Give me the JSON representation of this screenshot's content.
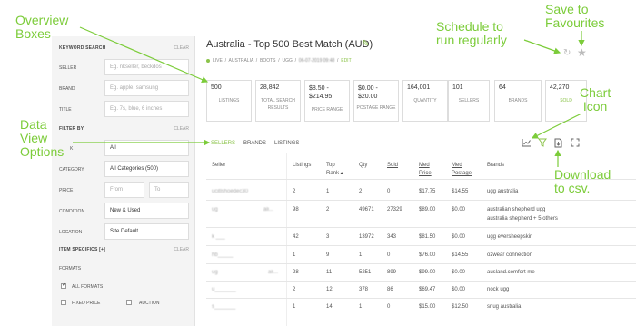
{
  "annotations": {
    "overview_boxes": [
      "Overview",
      "Boxes"
    ],
    "schedule": [
      "Schedule to",
      "run regularly"
    ],
    "favourites": [
      "Save to",
      "Favourites"
    ],
    "data_view": [
      "Data",
      "View",
      "Options"
    ],
    "chart_icon": [
      "Chart",
      "Icon"
    ],
    "download": [
      "Download",
      "to csv."
    ]
  },
  "colors": {
    "accent": "#8bc34a",
    "annotation": "#7ccc3a"
  },
  "sidebar": {
    "keyword_search": {
      "heading": "KEYWORD SEARCH",
      "clear": "CLEAR"
    },
    "seller": {
      "label": "SELLER",
      "placeholder": "Eg. nkseller, beckdos"
    },
    "brand": {
      "label": "BRAND",
      "placeholder": "Eg. apple, samsung"
    },
    "title": {
      "label": "TITLE",
      "placeholder": "Eg. 7s, blue, 6 inches"
    },
    "filter_by": {
      "heading": "FILTER BY",
      "clear": "CLEAR"
    },
    "kind": {
      "label": "K",
      "value": "All"
    },
    "category": {
      "label": "CATEGORY",
      "value": "All Categories (500)"
    },
    "price": {
      "label": "PRICE",
      "from": "From",
      "to": "To"
    },
    "condition": {
      "label": "CONDITION",
      "value": "New & Used"
    },
    "location": {
      "label": "LOCATION",
      "value": "Site Default"
    },
    "item_specifics": {
      "heading": "ITEM SPECIFICS [+]",
      "clear": "CLEAR"
    },
    "formats": {
      "label": "FORMATS",
      "all": "ALL FORMATS",
      "fixed": "FIXED PRICE",
      "auction": "AUCTION"
    }
  },
  "header": {
    "title": "Australia - Top 500 Best Match (AUD)",
    "status": "LIVE",
    "crumbs": [
      "AUSTRALIA",
      "BOOTS",
      "UGG",
      "06-07-2019 09:48"
    ],
    "edit": "EDIT",
    "schedule_icon": "clock-icon",
    "favourite_icon": "star-icon"
  },
  "overview": [
    {
      "value": "500",
      "label": "LISTINGS"
    },
    {
      "value": "28,842",
      "label": "TOTAL SEARCH RESULTS"
    },
    {
      "value": "$8.50 - $214.95",
      "label": "PRICE RANGE"
    },
    {
      "value": "$0.00 - $20.00",
      "label": "POSTAGE RANGE"
    },
    {
      "value": "164,001",
      "label": "QUANTITY"
    },
    {
      "value": "101",
      "label": "SELLERS"
    },
    {
      "value": "64",
      "label": "BRANDS"
    },
    {
      "value": "42,270",
      "label": "SOLD"
    }
  ],
  "tabs": [
    "SELLERS",
    "BRANDS",
    "LISTINGS"
  ],
  "toolbar": {
    "chart": "chart-icon",
    "filter": "filter-icon",
    "download": "download-csv-icon",
    "expand": "expand-icon"
  },
  "table": {
    "headers": [
      "Seller",
      "Listings",
      "Top Rank",
      "Qty",
      "Sold",
      "Med Price",
      "Med Postage",
      "Brands"
    ],
    "rows": [
      {
        "seller": "ucitlshoedec30",
        "listings": "2",
        "rank": "1",
        "qty": "2",
        "sold": "0",
        "price": "$17.75",
        "postage": "$14.55",
        "brands": [
          "ugg australia"
        ]
      },
      {
        "seller": "ug",
        "seller2": "ali...",
        "listings": "98",
        "rank": "2",
        "qty": "49671",
        "sold": "27329",
        "price": "$89.00",
        "postage": "$0.00",
        "brands": [
          "australian shepherd ugg",
          "australia shepherd + 5 others"
        ]
      },
      {
        "seller": "k  ___",
        "listings": "42",
        "rank": "3",
        "qty": "13972",
        "sold": "343",
        "price": "$81.50",
        "postage": "$0.00",
        "brands": [
          "ugg eversheepskin"
        ]
      },
      {
        "seller": "hb_____",
        "listings": "1",
        "rank": "9",
        "qty": "1",
        "sold": "0",
        "price": "$76.00",
        "postage": "$14.55",
        "brands": [
          "ozwear connection"
        ]
      },
      {
        "seller": "ug",
        "seller2": "ali...",
        "listings": "28",
        "rank": "11",
        "qty": "5251",
        "sold": "899",
        "price": "$99.00",
        "postage": "$0.00",
        "brands": [
          "ausland.comfort me"
        ]
      },
      {
        "seller": "u_______",
        "listings": "2",
        "rank": "12",
        "qty": "378",
        "sold": "86",
        "price": "$69.47",
        "postage": "$0.00",
        "brands": [
          "nock ugg"
        ]
      },
      {
        "seller": "s_______",
        "listings": "1",
        "rank": "14",
        "qty": "1",
        "sold": "0",
        "price": "$15.00",
        "postage": "$12.50",
        "brands": [
          "snug australia"
        ]
      }
    ]
  }
}
